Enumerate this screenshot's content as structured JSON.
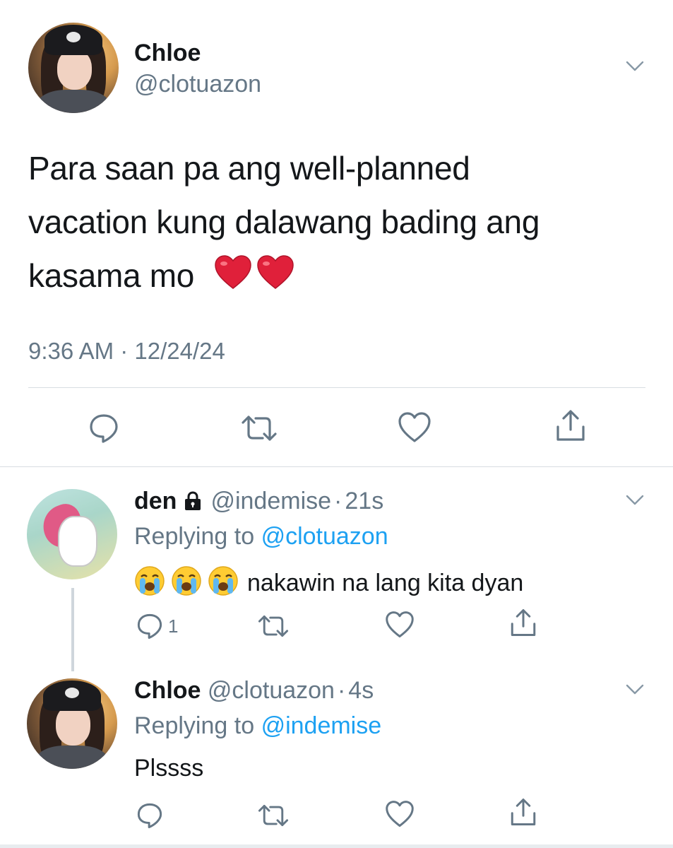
{
  "colors": {
    "text": "#14171a",
    "secondary": "#657786",
    "link": "#1da1f2",
    "divider": "#d8dde2"
  },
  "main_tweet": {
    "display_name": "Chloe",
    "handle": "@clotuazon",
    "text_line1": "Para saan pa ang well-planned",
    "text_line2": "vacation kung dalawang bading ang",
    "text_line3": "kasama mo",
    "text_emojis": [
      "red-heart",
      "red-heart"
    ],
    "time": "9:36 AM",
    "separator": "·",
    "date": "12/24/24",
    "actions": [
      "reply-icon",
      "retweet-icon",
      "like-icon",
      "share-icon"
    ]
  },
  "replies": [
    {
      "display_name": "den",
      "protected": true,
      "handle": "@indemise",
      "separator": "·",
      "age": "21s",
      "replying_label": "Replying to",
      "replying_handle": "@clotuazon",
      "emojis": [
        "loudly-crying-face",
        "loudly-crying-face",
        "loudly-crying-face"
      ],
      "text": "nakawin na lang kita dyan",
      "reply_count": "1"
    },
    {
      "display_name": "Chloe",
      "handle": "@clotuazon",
      "separator": "·",
      "age": "4s",
      "replying_label": "Replying to",
      "replying_handle": "@indemise",
      "text": "Plssss"
    }
  ]
}
